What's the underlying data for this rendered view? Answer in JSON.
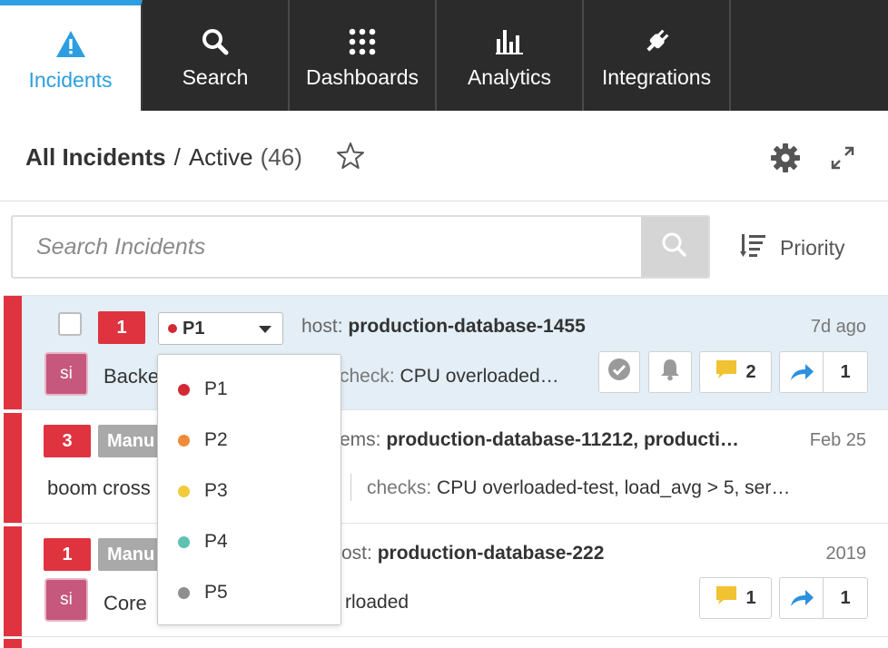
{
  "nav": {
    "tabs": [
      {
        "label": "Incidents",
        "icon": "warning-icon",
        "active": true
      },
      {
        "label": "Search",
        "icon": "search-icon"
      },
      {
        "label": "Dashboards",
        "icon": "grid-icon"
      },
      {
        "label": "Analytics",
        "icon": "bar-chart-icon"
      },
      {
        "label": "Integrations",
        "icon": "plug-icon"
      }
    ],
    "accent": "#2d9ee0"
  },
  "header": {
    "title": "All Incidents",
    "separator": "/",
    "subtitle": "Active",
    "count": "(46)"
  },
  "search": {
    "placeholder": "Search Incidents",
    "value": ""
  },
  "sort": {
    "label": "Priority"
  },
  "incidents": [
    {
      "count": "1",
      "priority": "P1",
      "host_label": "host:",
      "host": "production-database-1455",
      "time": "7d ago",
      "avatar": "si",
      "title": "Backe",
      "checks_label": "check:",
      "checks": "CPU overloaded…",
      "comments": "2",
      "shares": "1"
    },
    {
      "count": "3",
      "tag": "Manu",
      "host_label": "ems:",
      "host": "production-database-11212,  producti…",
      "time": "Feb 25",
      "title": "boom cross",
      "checks_label": "checks:",
      "checks": "CPU overloaded-test,  load_avg > 5,  ser…"
    },
    {
      "count": "1",
      "tag": "Manu",
      "host_label": "ost:",
      "host": "production-database-222",
      "time": "2019",
      "avatar": "si",
      "title": "Core",
      "checks": "rloaded",
      "comments": "1",
      "shares": "1"
    }
  ],
  "priority_dropdown": {
    "options": [
      {
        "label": "P1",
        "color": "#d22a35"
      },
      {
        "label": "P2",
        "color": "#ee8a38"
      },
      {
        "label": "P3",
        "color": "#f1cb3c"
      },
      {
        "label": "P4",
        "color": "#5fc1b0"
      },
      {
        "label": "P5",
        "color": "#8e8e8e"
      }
    ]
  },
  "colors": {
    "critical": "#e03340",
    "row_selected": "#e3eef6"
  }
}
